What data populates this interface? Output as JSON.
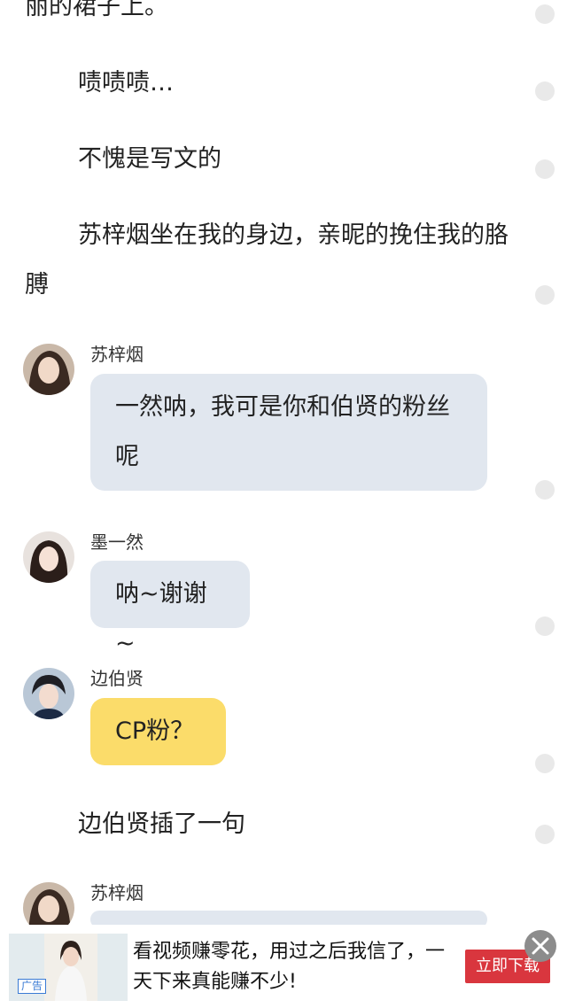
{
  "story": {
    "p_top": "丽的裙子上。",
    "p1": "啧啧啧…",
    "p2": "不愧是写文的",
    "p3": "苏梓烟坐在我的身边，亲昵的挽住我的胳膊",
    "p4": "边伯贤插了一句"
  },
  "chat": [
    {
      "name": "苏梓烟",
      "text": "一然呐，我可是你和伯贤的粉丝呢"
    },
    {
      "name": "墨一然",
      "text": "呐~谢谢~"
    },
    {
      "name": "边伯贤",
      "text": "CP粉？"
    },
    {
      "name": "苏梓烟",
      "text": ""
    }
  ],
  "ad": {
    "label": "广告",
    "text": "看视频赚零花，用过之后我信了，一天下来真能赚不少!",
    "button": "立即下载",
    "close_icon": "close-icon"
  },
  "colors": {
    "bubble_gray": "#e1e7ef",
    "bubble_yellow": "#fbdc6a",
    "ad_button": "#d9363e"
  }
}
